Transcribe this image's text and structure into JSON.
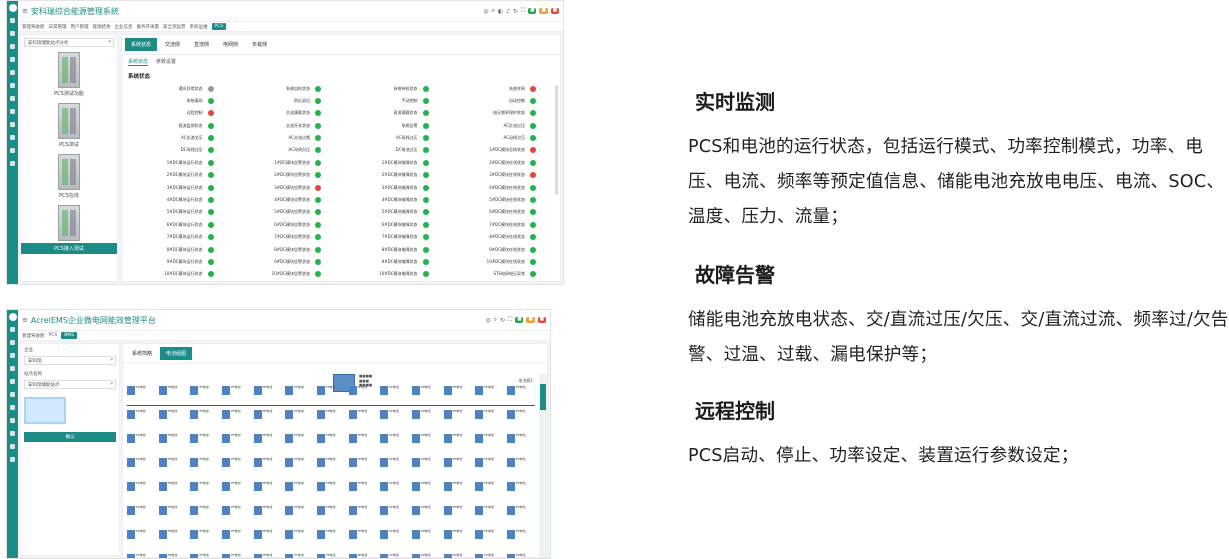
{
  "screenshot1": {
    "app_title": "安科瑞综合能源管理系统",
    "nav": [
      "管理驾驶舱",
      "日常管理",
      "用户管理",
      "能源结余",
      "企业信息",
      "服务开采量",
      "安全测运营",
      "系统运维",
      "PCS"
    ],
    "site_select": "安科瑞储能站点分析",
    "devices": [
      "PCS测试功能",
      "PCS测试",
      "PCS在线",
      "PCS接入测试"
    ],
    "tabs": [
      "系统状态",
      "交流侧",
      "直流侧",
      "电网侧",
      "负载侧"
    ],
    "subtabs": [
      "系统状态",
      "参数设置"
    ],
    "section_title": "系统状态",
    "statuses": [
      {
        "label": "通讯异常状态",
        "color": "y"
      },
      {
        "label": "系统自检状态",
        "color": "g"
      },
      {
        "label": "系统待机状态",
        "color": "g"
      },
      {
        "label": "系统并网",
        "color": "r"
      },
      {
        "label": "系统离网",
        "color": "g"
      },
      {
        "label": "防反退出",
        "color": "g"
      },
      {
        "label": "手动控制",
        "color": "g"
      },
      {
        "label": "自动控制",
        "color": "g"
      },
      {
        "label": "远程控制",
        "color": "r"
      },
      {
        "label": "交流满载状态",
        "color": "g"
      },
      {
        "label": "直流满载状态",
        "color": "g"
      },
      {
        "label": "电压频率保护状态",
        "color": "g"
      },
      {
        "label": "直流监测状态",
        "color": "g"
      },
      {
        "label": "交流开关状态",
        "color": "g"
      },
      {
        "label": "系统告警",
        "color": "g"
      },
      {
        "label": "AC交流过压",
        "color": "g"
      },
      {
        "label": "AC交流欠压",
        "color": "g"
      },
      {
        "label": "AC交流过频",
        "color": "g"
      },
      {
        "label": "AC母线过压",
        "color": "g"
      },
      {
        "label": "AC母线欠压",
        "color": "g"
      },
      {
        "label": "DC母线过压",
        "color": "g"
      },
      {
        "label": "AC母线欠压",
        "color": "g"
      },
      {
        "label": "DC电池过压",
        "color": "g"
      },
      {
        "label": "1#DC模块总线状态",
        "color": "r"
      },
      {
        "label": "1#DC模块运行状态",
        "color": "g"
      },
      {
        "label": "1#DC模块告警状态",
        "color": "g"
      },
      {
        "label": "1#DC模块故障状态",
        "color": "g"
      },
      {
        "label": "2#DC模块在线状态",
        "color": "g"
      },
      {
        "label": "2#DC模块运行状态",
        "color": "g"
      },
      {
        "label": "2#DC模块告警状态",
        "color": "g"
      },
      {
        "label": "2#DC模块故障状态",
        "color": "g"
      },
      {
        "label": "3#DC模块在线状态",
        "color": "r"
      },
      {
        "label": "3#DC模块运行状态",
        "color": "g"
      },
      {
        "label": "3#DC模块告警状态",
        "color": "r"
      },
      {
        "label": "3#DC模块故障状态",
        "color": "g"
      },
      {
        "label": "4#DC模块在线状态",
        "color": "g"
      },
      {
        "label": "4#DC模块运行状态",
        "color": "g"
      },
      {
        "label": "4#DC模块告警状态",
        "color": "g"
      },
      {
        "label": "4#DC模块故障状态",
        "color": "g"
      },
      {
        "label": "5#DC模块在线状态",
        "color": "g"
      },
      {
        "label": "5#DC模块运行状态",
        "color": "g"
      },
      {
        "label": "5#DC模块告警状态",
        "color": "g"
      },
      {
        "label": "5#DC模块故障状态",
        "color": "g"
      },
      {
        "label": "6#DC模块在线状态",
        "color": "g"
      },
      {
        "label": "6#DC模块运行状态",
        "color": "g"
      },
      {
        "label": "6#DC模块告警状态",
        "color": "g"
      },
      {
        "label": "6#DC模块故障状态",
        "color": "g"
      },
      {
        "label": "7#DC模块在线状态",
        "color": "g"
      },
      {
        "label": "7#DC模块运行状态",
        "color": "g"
      },
      {
        "label": "7#DC模块告警状态",
        "color": "g"
      },
      {
        "label": "7#DC模块故障状态",
        "color": "g"
      },
      {
        "label": "8#DC模块在线状态",
        "color": "g"
      },
      {
        "label": "8#DC模块运行状态",
        "color": "g"
      },
      {
        "label": "8#DC模块告警状态",
        "color": "g"
      },
      {
        "label": "8#DC模块故障状态",
        "color": "g"
      },
      {
        "label": "9#DC模块在线状态",
        "color": "g"
      },
      {
        "label": "9#DC模块运行状态",
        "color": "g"
      },
      {
        "label": "9#DC模块告警状态",
        "color": "g"
      },
      {
        "label": "9#DC模块故障状态",
        "color": "g"
      },
      {
        "label": "10#DC模块在线状态",
        "color": "g"
      },
      {
        "label": "10#DC模块运行状态",
        "color": "g"
      },
      {
        "label": "10#DC模块告警状态",
        "color": "g"
      },
      {
        "label": "10#DC模块故障状态",
        "color": "g"
      },
      {
        "label": "STS电网电压异常",
        "color": "g"
      }
    ]
  },
  "screenshot2": {
    "app_title": "AcrelEMS企业微电网能效管理平台",
    "nav": [
      "管理驾驶舱",
      "PCS",
      "BMS"
    ],
    "company_label": "企业",
    "company_value": "安科瑞",
    "site_label": "站点名称",
    "site_value": "安科瑞储能站点",
    "confirm_button": "确认",
    "tabs": [
      "系统简略",
      "电池组图"
    ],
    "legend": "电池簇1",
    "unit_label": "PP电池",
    "unit_count": 13
  },
  "features": [
    {
      "title": "实时监测",
      "body": "PCS和电池的运行状态，包括运行模式、功率控制模式，功率、电压、电流、频率等预定值信息、储能电池充放电电压、电流、SOC、温度、压力、流量；"
    },
    {
      "title": "故障告警",
      "body": "储能电池充放电状态、交/直流过压/欠压、交/直流过流、频率过/欠告警、过温、过载、漏电保护等；"
    },
    {
      "title": "远程控制",
      "body": "PCS启动、停止、功率设定、装置运行参数设定；"
    }
  ],
  "colors": {
    "accent": "#1b8c86",
    "ok": "#23b34a",
    "alarm": "#e2463c"
  }
}
